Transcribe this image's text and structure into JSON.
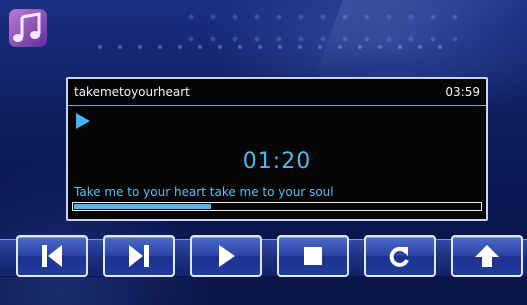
{
  "app": {
    "icon": "music-note-icon"
  },
  "player": {
    "track_title": "takemetoyourheart",
    "duration": "03:59",
    "elapsed": "01:20",
    "lyric": "Take me to your heart take me to your soul",
    "progress_fraction": 0.335,
    "state_icon": "play-indicator-icon"
  },
  "controls": [
    {
      "name": "previous-button",
      "icon": "skip-previous-icon"
    },
    {
      "name": "next-button",
      "icon": "skip-next-icon"
    },
    {
      "name": "play-button",
      "icon": "play-icon"
    },
    {
      "name": "stop-button",
      "icon": "stop-icon"
    },
    {
      "name": "repeat-button",
      "icon": "repeat-icon"
    },
    {
      "name": "back-button",
      "icon": "up-arrow-icon"
    }
  ],
  "colors": {
    "accent": "#4fb6ef",
    "panel_background": "#050505",
    "button_border": "#dfe7fb"
  }
}
